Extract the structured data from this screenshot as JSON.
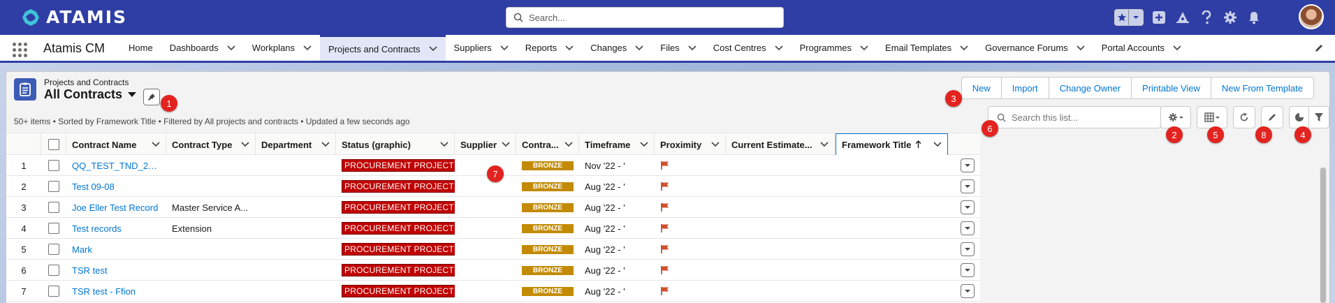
{
  "header": {
    "logo_text": "ATAMIS",
    "search_placeholder": "Search...",
    "icons": [
      "favorites-star-icon",
      "favorites-dropdown-icon",
      "global-actions-icon",
      "trailhead-icon",
      "help-icon",
      "setup-gear-icon",
      "notifications-bell-icon"
    ]
  },
  "nav": {
    "app_name": "Atamis CM",
    "items": [
      {
        "label": "Home",
        "has_menu": false
      },
      {
        "label": "Dashboards",
        "has_menu": true
      },
      {
        "label": "Workplans",
        "has_menu": true
      },
      {
        "label": "Projects and Contracts",
        "has_menu": true,
        "active": true
      },
      {
        "label": "Suppliers",
        "has_menu": true
      },
      {
        "label": "Reports",
        "has_menu": true
      },
      {
        "label": "Changes",
        "has_menu": true
      },
      {
        "label": "Files",
        "has_menu": true
      },
      {
        "label": "Cost Centres",
        "has_menu": true
      },
      {
        "label": "Programmes",
        "has_menu": true
      },
      {
        "label": "Email Templates",
        "has_menu": true
      },
      {
        "label": "Governance Forums",
        "has_menu": true
      },
      {
        "label": "Portal Accounts",
        "has_menu": true
      }
    ]
  },
  "list_view": {
    "object_label": "Projects and Contracts",
    "title": "All Contracts",
    "meta": "50+ items • Sorted by Framework Title • Filtered by All projects and contracts • Updated a few seconds ago",
    "actions": [
      "New",
      "Import",
      "Change Owner",
      "Printable View",
      "New From Template"
    ],
    "search_placeholder": "Search this list..."
  },
  "table": {
    "columns": [
      "Contract Name",
      "Contract Type",
      "Department",
      "Status (graphic)",
      "Supplier",
      "Contra...",
      "Timeframe",
      "Proximity",
      "Current Estimate...",
      "Framework Title"
    ],
    "sorted_column": "Framework Title",
    "rows": [
      {
        "num": "1",
        "name": "QQ_TEST_TND_2022...",
        "type": "",
        "status": "PROCUREMENT PROJECT",
        "tier": "BRONZE",
        "timeframe": "Nov '22 - '"
      },
      {
        "num": "2",
        "name": "Test 09-08",
        "type": "",
        "status": "PROCUREMENT PROJECT",
        "tier": "BRONZE",
        "timeframe": "Aug '22 - '"
      },
      {
        "num": "3",
        "name": "Joe Eller Test Record",
        "type": "Master Service A...",
        "status": "PROCUREMENT PROJECT",
        "tier": "BRONZE",
        "timeframe": "Aug '22 - '"
      },
      {
        "num": "4",
        "name": "Test records",
        "type": "Extension",
        "status": "PROCUREMENT PROJECT",
        "tier": "BRONZE",
        "timeframe": "Aug '22 - '"
      },
      {
        "num": "5",
        "name": "Mark",
        "type": "",
        "status": "PROCUREMENT PROJECT",
        "tier": "BRONZE",
        "timeframe": "Aug '22 - '"
      },
      {
        "num": "6",
        "name": "TSR test",
        "type": "",
        "status": "PROCUREMENT PROJECT",
        "tier": "BRONZE",
        "timeframe": "Aug '22 - '"
      },
      {
        "num": "7",
        "name": "TSR test - Ffion",
        "type": "",
        "status": "PROCUREMENT PROJECT",
        "tier": "BRONZE",
        "timeframe": "Aug '22 - '"
      }
    ]
  },
  "markers": [
    "1",
    "2",
    "3",
    "4",
    "5",
    "6",
    "7",
    "8"
  ],
  "colors": {
    "header_bg": "#2f3ea4",
    "link": "#0176d3",
    "status_red": "#c00000",
    "bronze": "#c38b04",
    "marker_red": "#e3231f",
    "flag": "#d4502a"
  }
}
